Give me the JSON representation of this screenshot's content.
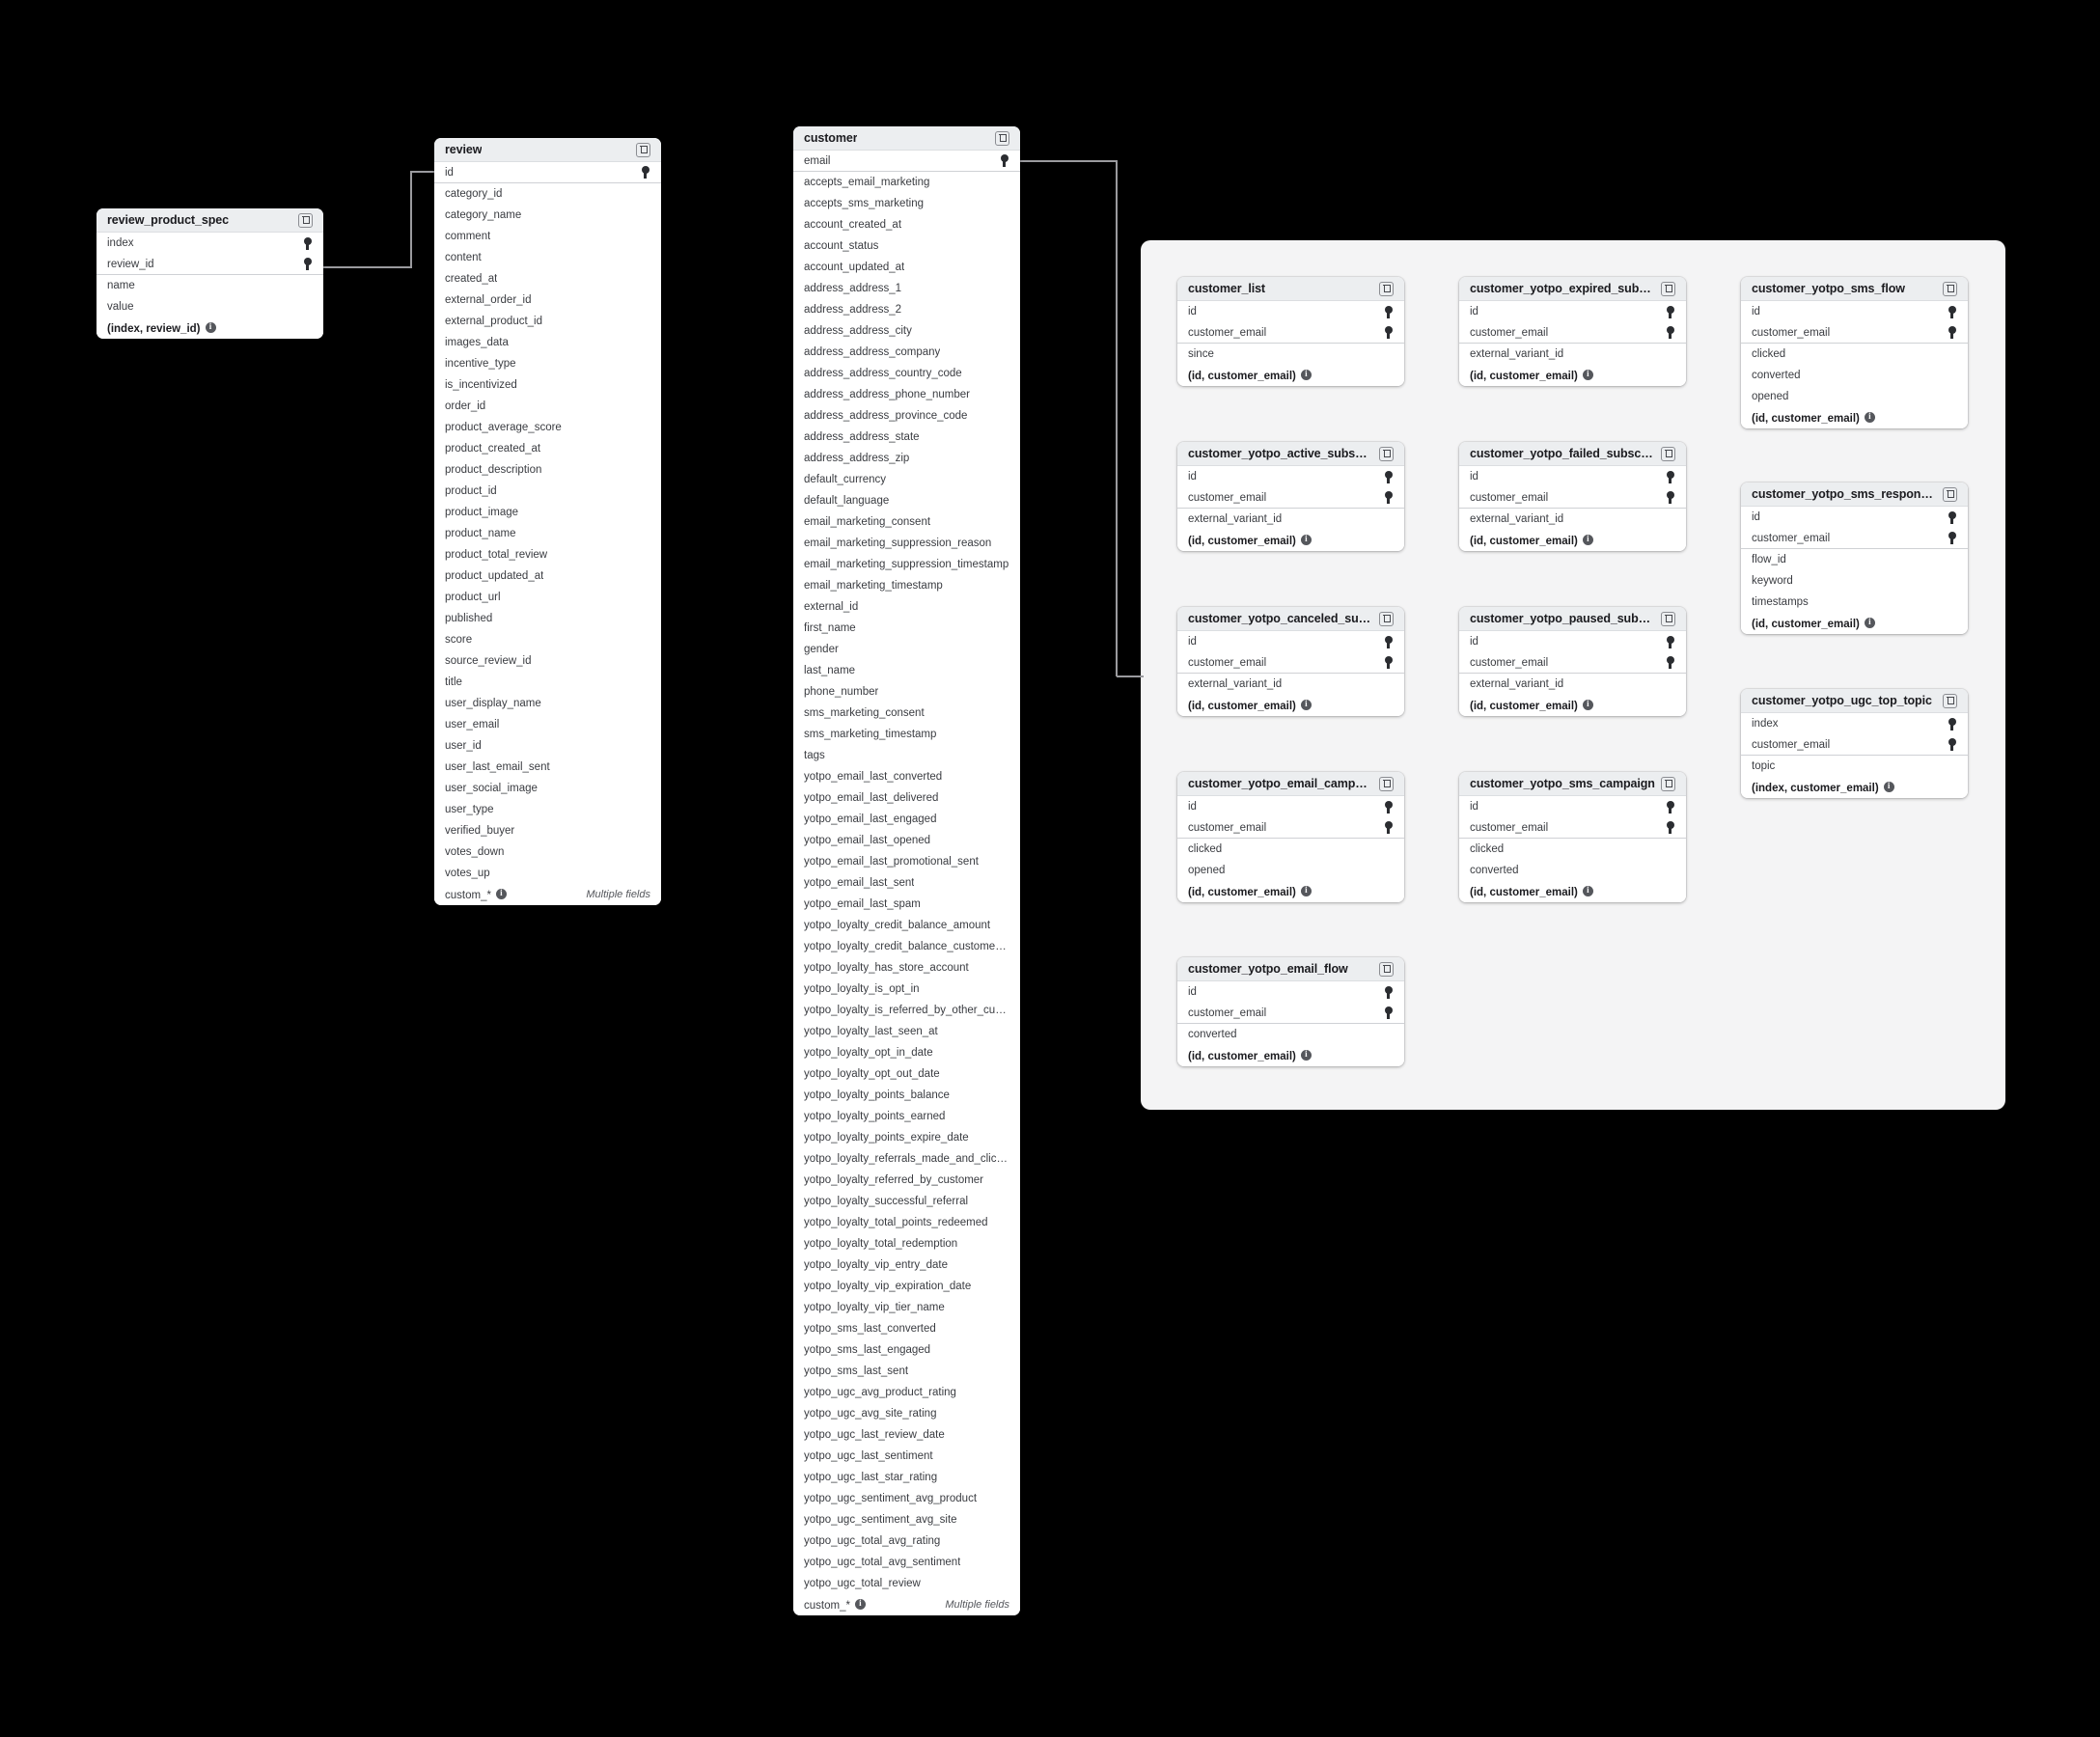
{
  "theme": {
    "canvas_bg": "#000000",
    "group_panel_bg": "#f4f4f5",
    "card_bg": "#ffffff",
    "card_header_bg": "#eceef0",
    "text_color": "#3a3c41",
    "title_color": "#1b1b1f",
    "edge_color": "#9a9a9e"
  },
  "labels": {
    "multiple_fields": "Multiple fields",
    "custom_field": "custom_*",
    "open_icon": "external-link-icon",
    "pk_icon": "key-icon",
    "info_icon": "info-icon"
  },
  "tables": {
    "review_product_spec": {
      "title": "review_product_spec",
      "keys": [
        "index",
        "review_id"
      ],
      "fields": [
        "name",
        "value"
      ],
      "footer": "(index, review_id)"
    },
    "review": {
      "title": "review",
      "keys": [
        "id"
      ],
      "fields": [
        "category_id",
        "category_name",
        "comment",
        "content",
        "created_at",
        "external_order_id",
        "external_product_id",
        "images_data",
        "incentive_type",
        "is_incentivized",
        "order_id",
        "product_average_score",
        "product_created_at",
        "product_description",
        "product_id",
        "product_image",
        "product_name",
        "product_total_review",
        "product_updated_at",
        "product_url",
        "published",
        "score",
        "source_review_id",
        "title",
        "user_display_name",
        "user_email",
        "user_id",
        "user_last_email_sent",
        "user_social_image",
        "user_type",
        "verified_buyer",
        "votes_down",
        "votes_up"
      ],
      "footer": null,
      "custom_row": true
    },
    "customer": {
      "title": "customer",
      "keys": [
        "email"
      ],
      "fields": [
        "accepts_email_marketing",
        "accepts_sms_marketing",
        "account_created_at",
        "account_status",
        "account_updated_at",
        "address_address_1",
        "address_address_2",
        "address_address_city",
        "address_address_company",
        "address_address_country_code",
        "address_address_phone_number",
        "address_address_province_code",
        "address_address_state",
        "address_address_zip",
        "default_currency",
        "default_language",
        "email_marketing_consent",
        "email_marketing_suppression_reason",
        "email_marketing_suppression_timestamp",
        "email_marketing_timestamp",
        "external_id",
        "first_name",
        "gender",
        "last_name",
        "phone_number",
        "sms_marketing_consent",
        "sms_marketing_timestamp",
        "tags",
        "yotpo_email_last_converted",
        "yotpo_email_last_delivered",
        "yotpo_email_last_engaged",
        "yotpo_email_last_opened",
        "yotpo_email_last_promotional_sent",
        "yotpo_email_last_sent",
        "yotpo_email_last_spam",
        "yotpo_loyalty_credit_balance_amount",
        "yotpo_loyalty_credit_balance_customer_currency",
        "yotpo_loyalty_has_store_account",
        "yotpo_loyalty_is_opt_in",
        "yotpo_loyalty_is_referred_by_other_customer",
        "yotpo_loyalty_last_seen_at",
        "yotpo_loyalty_opt_in_date",
        "yotpo_loyalty_opt_out_date",
        "yotpo_loyalty_points_balance",
        "yotpo_loyalty_points_earned",
        "yotpo_loyalty_points_expire_date",
        "yotpo_loyalty_referrals_made_and_clicked",
        "yotpo_loyalty_referred_by_customer",
        "yotpo_loyalty_successful_referral",
        "yotpo_loyalty_total_points_redeemed",
        "yotpo_loyalty_total_redemption",
        "yotpo_loyalty_vip_entry_date",
        "yotpo_loyalty_vip_expiration_date",
        "yotpo_loyalty_vip_tier_name",
        "yotpo_sms_last_converted",
        "yotpo_sms_last_engaged",
        "yotpo_sms_last_sent",
        "yotpo_ugc_avg_product_rating",
        "yotpo_ugc_avg_site_rating",
        "yotpo_ugc_last_review_date",
        "yotpo_ugc_last_sentiment",
        "yotpo_ugc_last_star_rating",
        "yotpo_ugc_sentiment_avg_product",
        "yotpo_ugc_sentiment_avg_site",
        "yotpo_ugc_total_avg_rating",
        "yotpo_ugc_total_avg_sentiment",
        "yotpo_ugc_total_review"
      ],
      "footer": null,
      "custom_row": true
    },
    "customer_list": {
      "title": "customer_list",
      "keys": [
        "id",
        "customer_email"
      ],
      "fields": [
        "since"
      ],
      "footer": "(id, customer_email)"
    },
    "customer_yotpo_expired_subscription": {
      "title": "customer_yotpo_expired_subscription",
      "keys": [
        "id",
        "customer_email"
      ],
      "fields": [
        "external_variant_id"
      ],
      "footer": "(id, customer_email)"
    },
    "customer_yotpo_sms_flow": {
      "title": "customer_yotpo_sms_flow",
      "keys": [
        "id",
        "customer_email"
      ],
      "fields": [
        "clicked",
        "converted",
        "opened"
      ],
      "footer": "(id, customer_email)"
    },
    "customer_yotpo_active_subscription": {
      "title": "customer_yotpo_active_subscription",
      "keys": [
        "id",
        "customer_email"
      ],
      "fields": [
        "external_variant_id"
      ],
      "footer": "(id, customer_email)"
    },
    "customer_yotpo_failed_subscription": {
      "title": "customer_yotpo_failed_subscription",
      "keys": [
        "id",
        "customer_email"
      ],
      "fields": [
        "external_variant_id"
      ],
      "footer": "(id, customer_email)"
    },
    "customer_yotpo_sms_response_message": {
      "title": "customer_yotpo_sms_response_mess...",
      "keys": [
        "id",
        "customer_email"
      ],
      "fields": [
        "flow_id",
        "keyword",
        "timestamps"
      ],
      "footer": "(id, customer_email)"
    },
    "customer_yotpo_canceled_subscription": {
      "title": "customer_yotpo_canceled_subscription",
      "keys": [
        "id",
        "customer_email"
      ],
      "fields": [
        "external_variant_id"
      ],
      "footer": "(id, customer_email)"
    },
    "customer_yotpo_paused_subscription": {
      "title": "customer_yotpo_paused_subscription",
      "keys": [
        "id",
        "customer_email"
      ],
      "fields": [
        "external_variant_id"
      ],
      "footer": "(id, customer_email)"
    },
    "customer_yotpo_ugc_top_topic": {
      "title": "customer_yotpo_ugc_top_topic",
      "keys": [
        "index",
        "customer_email"
      ],
      "fields": [
        "topic"
      ],
      "footer": "(index, customer_email)"
    },
    "customer_yotpo_email_campaign": {
      "title": "customer_yotpo_email_campaign",
      "keys": [
        "id",
        "customer_email"
      ],
      "fields": [
        "clicked",
        "opened"
      ],
      "footer": "(id, customer_email)"
    },
    "customer_yotpo_sms_campaign": {
      "title": "customer_yotpo_sms_campaign",
      "keys": [
        "id",
        "customer_email"
      ],
      "fields": [
        "clicked",
        "converted"
      ],
      "footer": "(id, customer_email)"
    },
    "customer_yotpo_email_flow": {
      "title": "customer_yotpo_email_flow",
      "keys": [
        "id",
        "customer_email"
      ],
      "fields": [
        "converted"
      ],
      "footer": "(id, customer_email)"
    }
  }
}
